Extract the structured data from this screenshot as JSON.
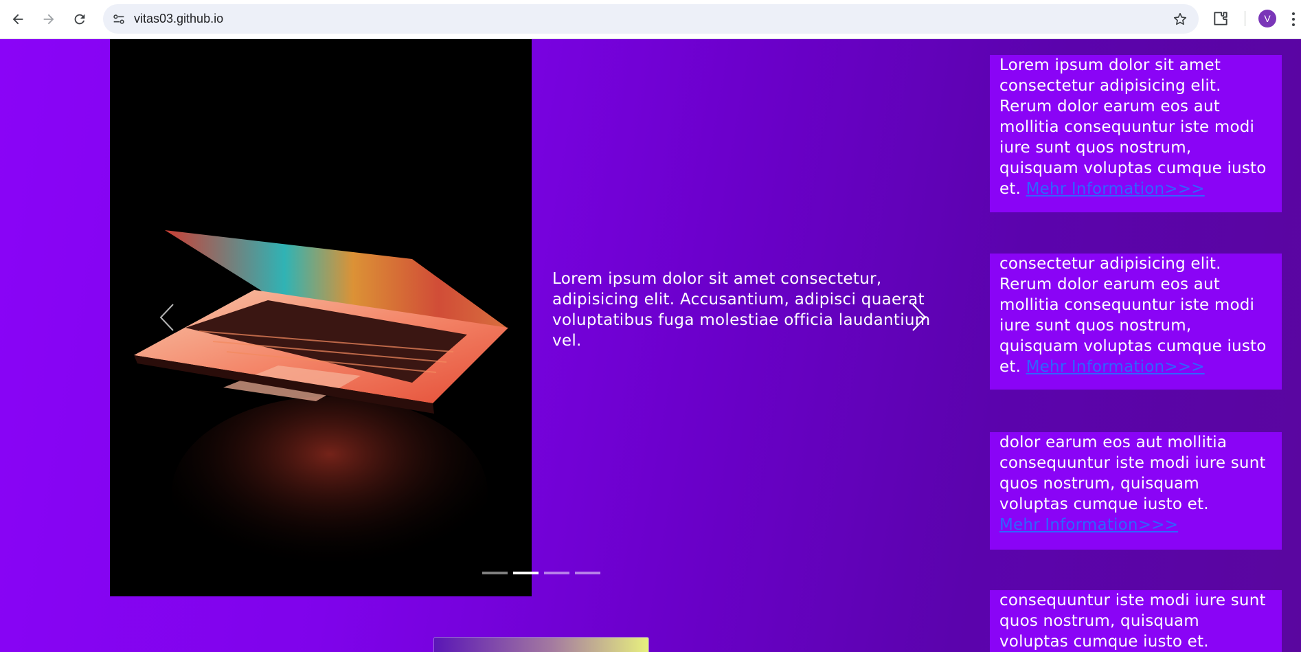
{
  "browser": {
    "url": "vitas03.github.io",
    "profile_initial": "V",
    "icons": [
      "back-icon",
      "forward-icon",
      "reload-icon",
      "site-info-icon",
      "bookmark-star-icon",
      "extensions-icon",
      "menu-icon"
    ]
  },
  "slider": {
    "text": "Lorem ipsum dolor sit amet consectetur, adipisicing elit. Accusantium, adipisci quaerat voluptatibus fuga molestiae officia laudantium vel.",
    "indicator_count": 4,
    "active_indicator": 1
  },
  "cards": [
    {
      "text": "Lorem ipsum dolor sit amet consectetur adipisicing elit. Rerum dolor earum eos aut mollitia consequuntur iste modi iure sunt quos nostrum, quisquam voluptas cumque iusto et. ",
      "link": "Mehr Information>>>"
    },
    {
      "text": "consectetur adipisicing elit. Rerum dolor earum eos aut mollitia consequuntur iste modi iure sunt quos nostrum, quisquam voluptas cumque iusto et. ",
      "link": "Mehr Information>>>"
    },
    {
      "text": "dolor earum eos aut mollitia consequuntur iste modi iure sunt quos nostrum, quisquam voluptas cumque iusto et.",
      "link": "Mehr Information>>>"
    },
    {
      "text": "consequuntur iste modi iure sunt quos nostrum, quisquam voluptas cumque iusto et."
    }
  ],
  "colors": {
    "page_bg": "#8a05f5",
    "card_bg": "#8a04f6",
    "link": "#2f64ff"
  }
}
